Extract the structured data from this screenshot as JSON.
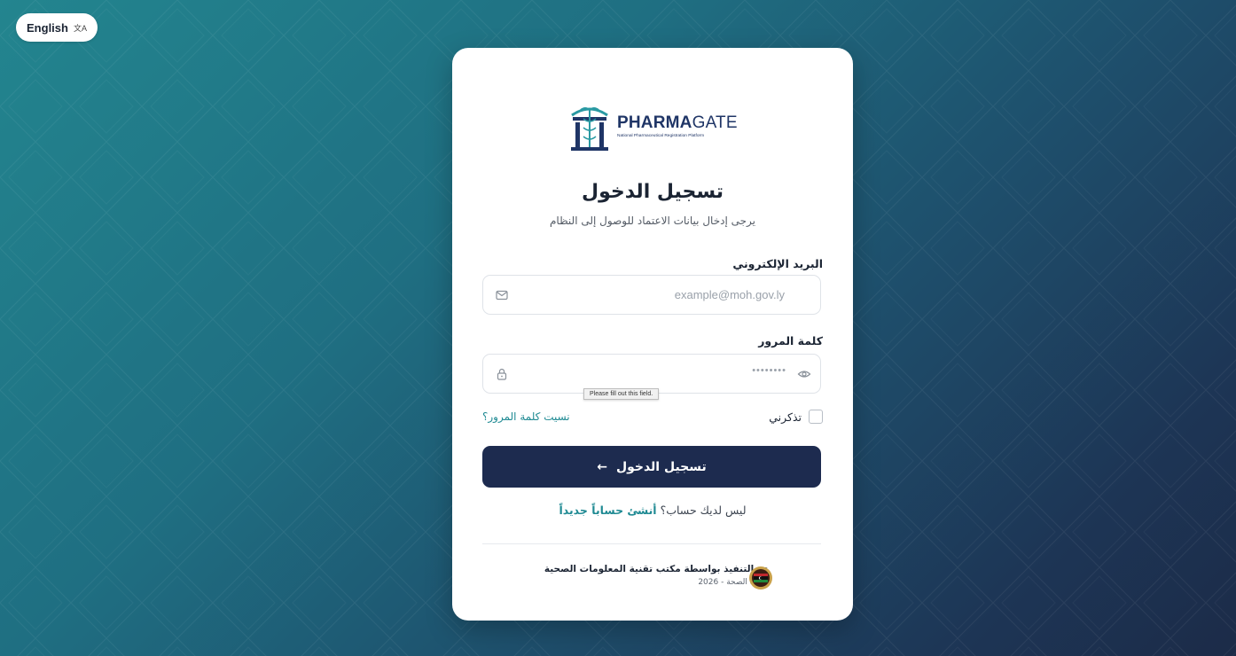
{
  "language_button": {
    "label": "English",
    "icon": "translate-icon"
  },
  "logo": {
    "brand_bold": "PHARMA",
    "brand_light": "GATE",
    "tagline": "National Pharmaceutical Registration Platform"
  },
  "login": {
    "title": "تسجيل الدخول",
    "subtitle": "يرجى إدخال بيانات الاعتماد للوصول إلى النظام",
    "email_label": "البريد الإلكتروني",
    "email_placeholder": "example@moh.gov.ly",
    "password_label": "كلمة المرور",
    "password_placeholder": "••••••••",
    "validation_tooltip": "Please fill out this field.",
    "remember_label": "تذكرني",
    "forgot_link": "نسيت كلمة المرور؟",
    "submit_label": "تسجيل الدخول",
    "signup_prompt": "ليس لديك حساب؟",
    "signup_link": "أنشئ حساباً جديداً"
  },
  "footer": {
    "line1": "تم التنفيذ بواسطة مكتب تقنية المعلومات الصحية",
    "line2": "وزارة الصحة - 2026"
  },
  "colors": {
    "primary": "#1d2b4f",
    "accent": "#1f8a93",
    "bg_start": "#23858f",
    "bg_end": "#1c2b48"
  }
}
